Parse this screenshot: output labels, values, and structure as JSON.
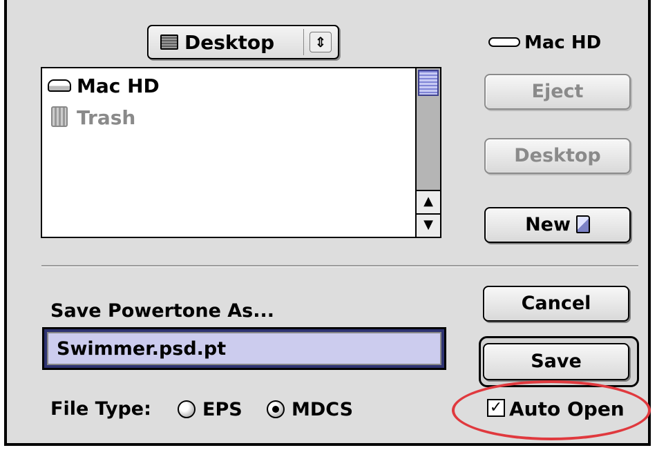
{
  "location_popup": {
    "label": "Desktop",
    "arrows": "⇕"
  },
  "volume": {
    "name": "Mac HD"
  },
  "file_list": {
    "items": [
      {
        "label": "Mac HD"
      },
      {
        "label": "Trash"
      }
    ],
    "scroll_up": "▲",
    "scroll_down": "▼"
  },
  "buttons": {
    "eject": "Eject",
    "desktop": "Desktop",
    "new": "New",
    "cancel": "Cancel",
    "save": "Save"
  },
  "save_prompt": "Save Powertone As...",
  "filename": {
    "value": "Swimmer.psd.pt"
  },
  "file_type": {
    "label": "File Type:",
    "options": [
      {
        "label": "EPS",
        "selected": false
      },
      {
        "label": "MDCS",
        "selected": true
      }
    ]
  },
  "auto_open": {
    "label": "Auto Open",
    "checked": true,
    "checkmark": "✓"
  },
  "annotation_color": "#e0393e"
}
